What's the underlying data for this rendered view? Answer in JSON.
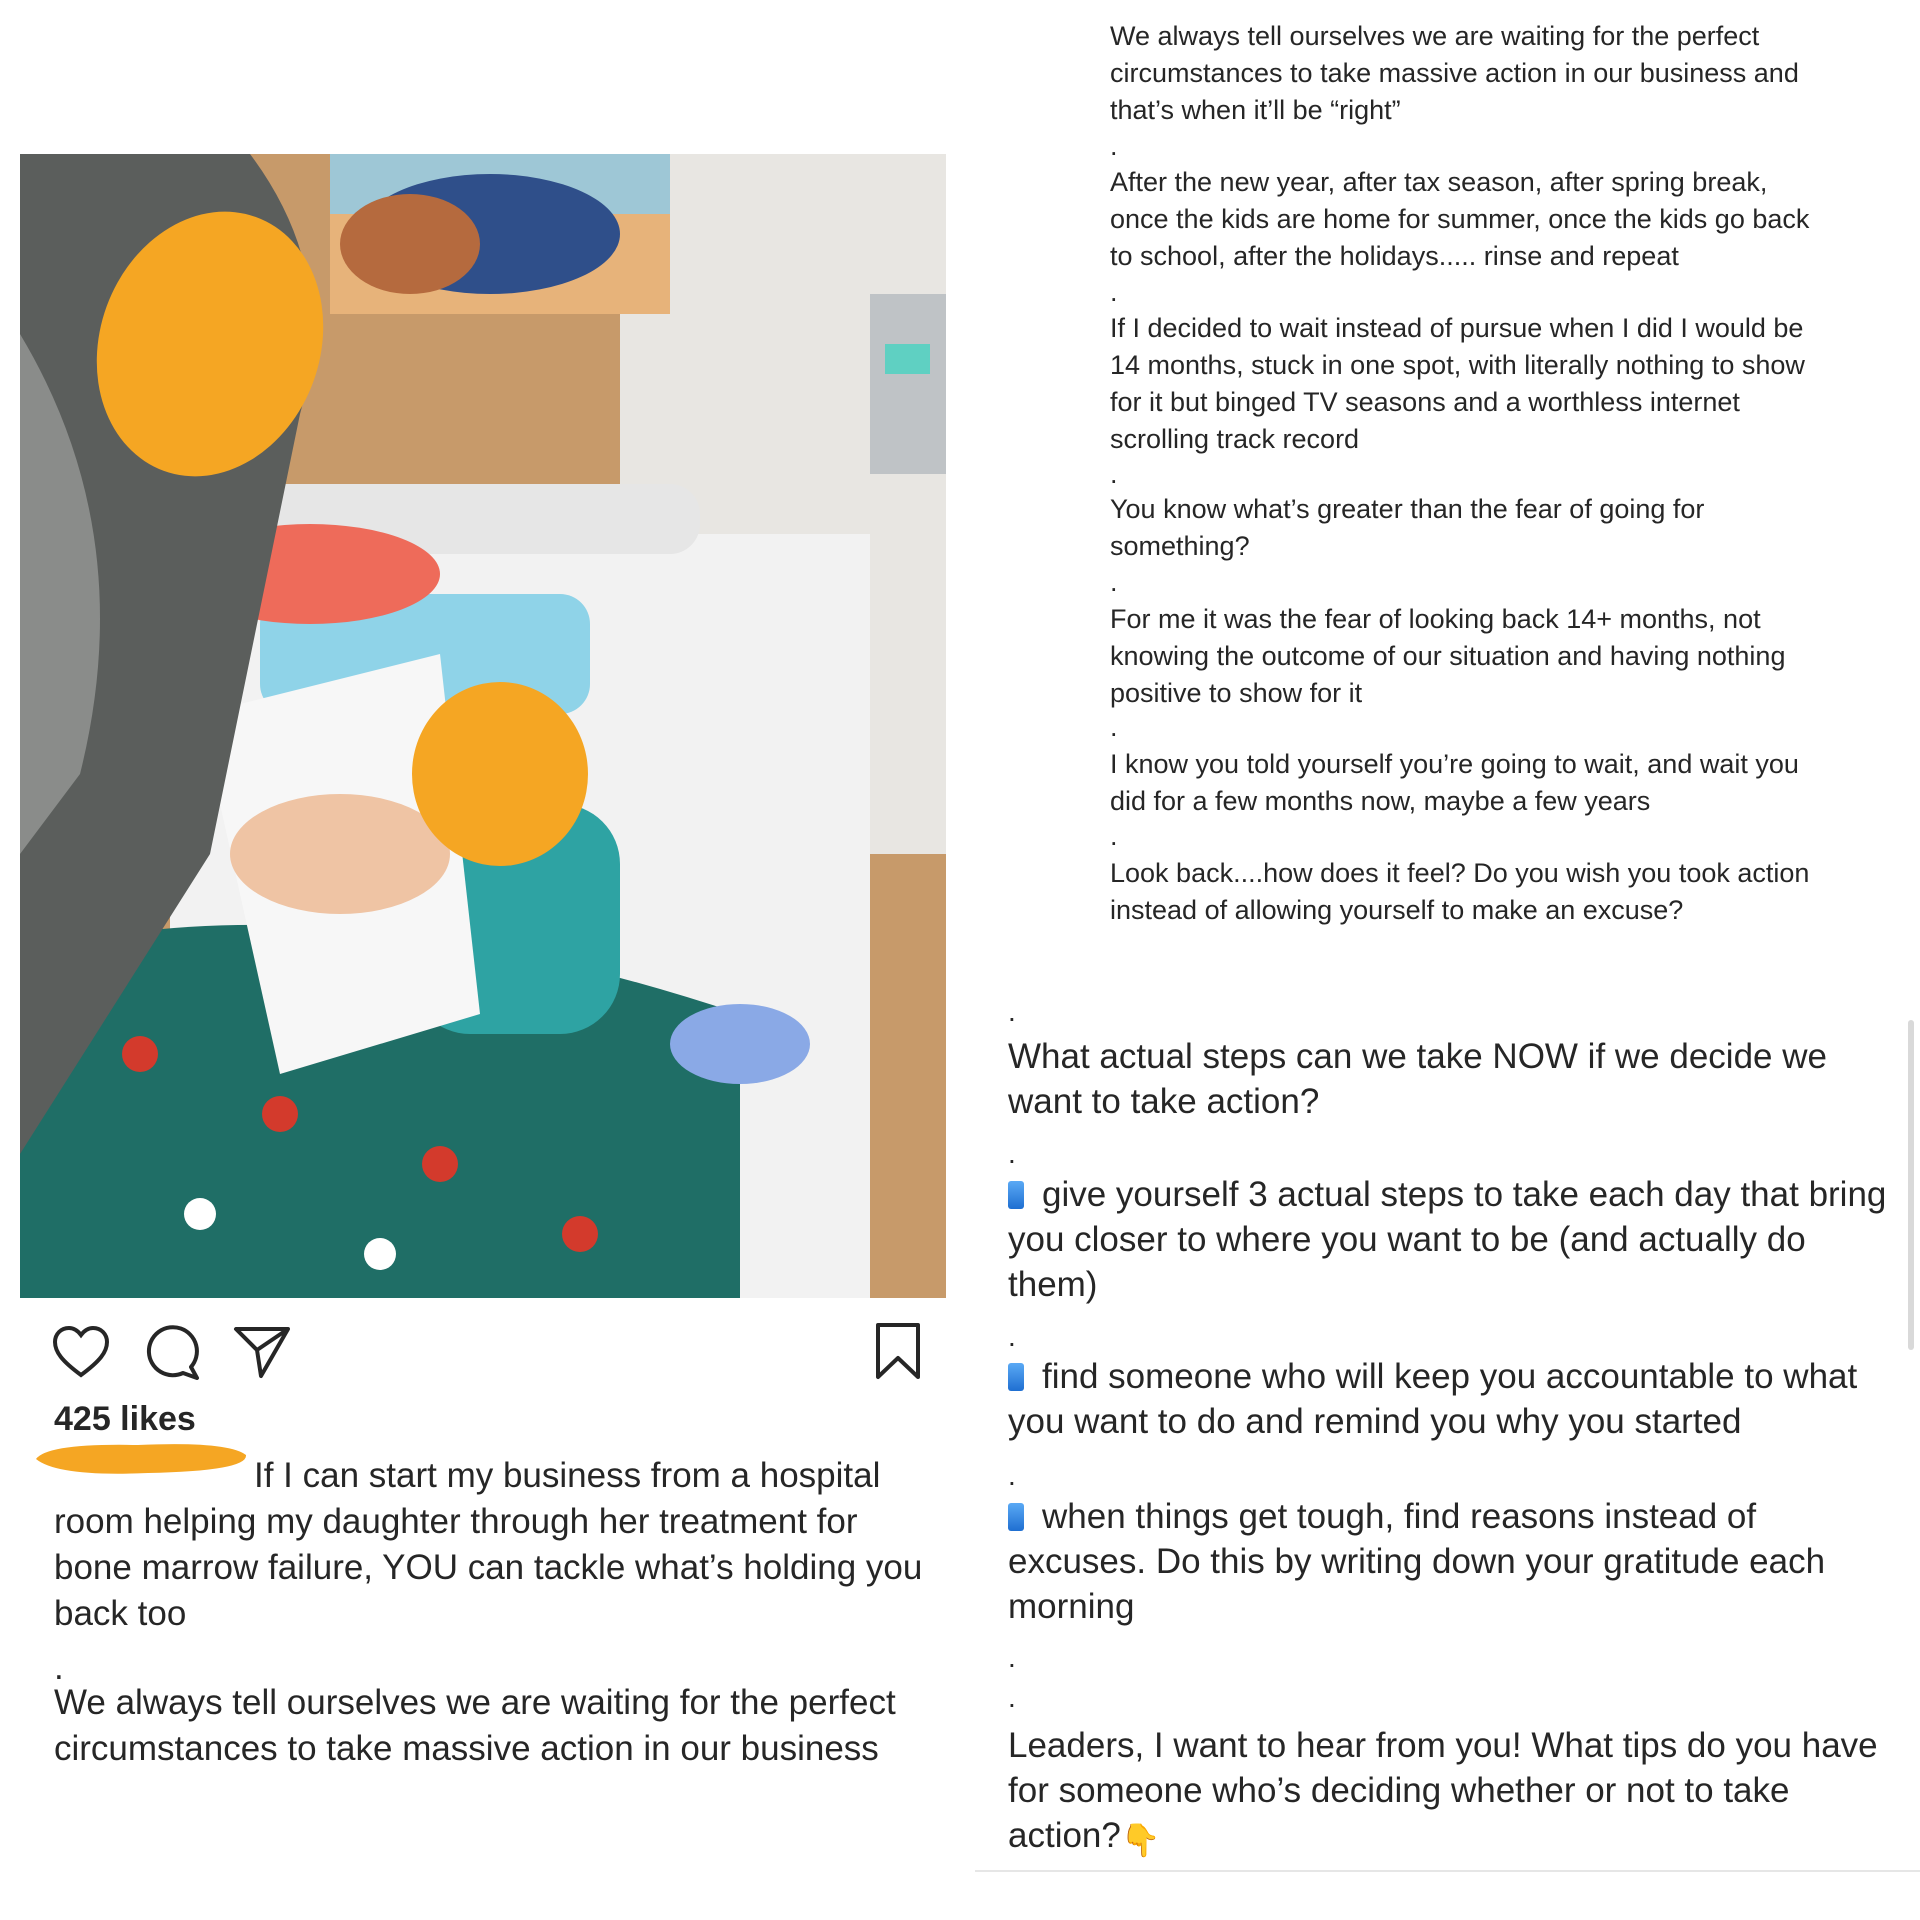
{
  "post": {
    "likes": "425 likes",
    "caption": "If I can start my business from a hospital room helping my daughter through her treatment for bone marrow failure, YOU can tackle what’s holding you back too",
    "caption_dot": ".",
    "caption_more": "We always tell ourselves we are waiting for the perfect circumstances to take massive action in our business"
  },
  "actions": {
    "like": "heart-icon",
    "comment": "comment-icon",
    "share": "send-icon",
    "save": "bookmark-icon"
  },
  "continued": {
    "p1": "We always tell ourselves we are waiting for the perfect circumstances to take massive action in our business and that’s when it’ll be “right”",
    "p2": "After the new year, after tax season, after spring break, once the kids are home for summer, once the kids go back to school, after the holidays..... rinse and repeat",
    "p3": "If I decided to wait instead of pursue when I did I would be 14 months, stuck in one spot, with literally nothing to show for it but binged TV seasons and a worthless internet scrolling track record",
    "p4": "You know what’s greater than the fear of going for something?",
    "p5": "For me it was the fear of looking back 14+ months, not knowing the outcome of our situation and having nothing positive to show for it",
    "p6": "I know you told yourself you’re going to wait, and wait you did for a few months now, maybe a few years",
    "p7": "Look back....how does it feel? Do you wish you took action instead of allowing yourself to make an excuse?",
    "dot": "."
  },
  "steps": {
    "question": "What actual steps can we take NOW if we decide we want to take action?",
    "step1": "give yourself 3 actual steps to take each day that bring you closer to where you want to be (and actually do them)",
    "step2": "find someone who will keep you accountable to what you want to do and remind you why you started",
    "step3": "when things get tough, find reasons instead of excuses. Do this by writing down your gratitude each morning",
    "closing": "Leaders, I want to hear from you! What tips do you have for someone who’s deciding whether or not to take action?",
    "dot": "."
  },
  "colors": {
    "redaction": "#f5a623",
    "text": "#262626"
  }
}
